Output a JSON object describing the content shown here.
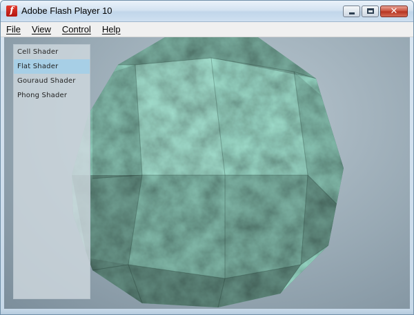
{
  "window": {
    "title": "Adobe Flash Player 10",
    "app_icon_glyph": "f",
    "controls": {
      "minimize_icon": "minimize-icon",
      "maximize_icon": "maximize-icon",
      "close_icon": "close-icon",
      "close_glyph": "✕"
    }
  },
  "menu": {
    "items": [
      {
        "label": "File"
      },
      {
        "label": "View"
      },
      {
        "label": "Control"
      },
      {
        "label": "Help"
      }
    ]
  },
  "shader_panel": {
    "items": [
      {
        "label": "Cell Shader",
        "selected": false
      },
      {
        "label": "Flat Shader",
        "selected": true
      },
      {
        "label": "Gouraud Shader",
        "selected": false
      },
      {
        "label": "Phong Shader",
        "selected": false
      }
    ]
  },
  "colors": {
    "selection": "#a7cfe6",
    "sphere_base": "#3f6b5f",
    "close_button": "#c74c39"
  }
}
